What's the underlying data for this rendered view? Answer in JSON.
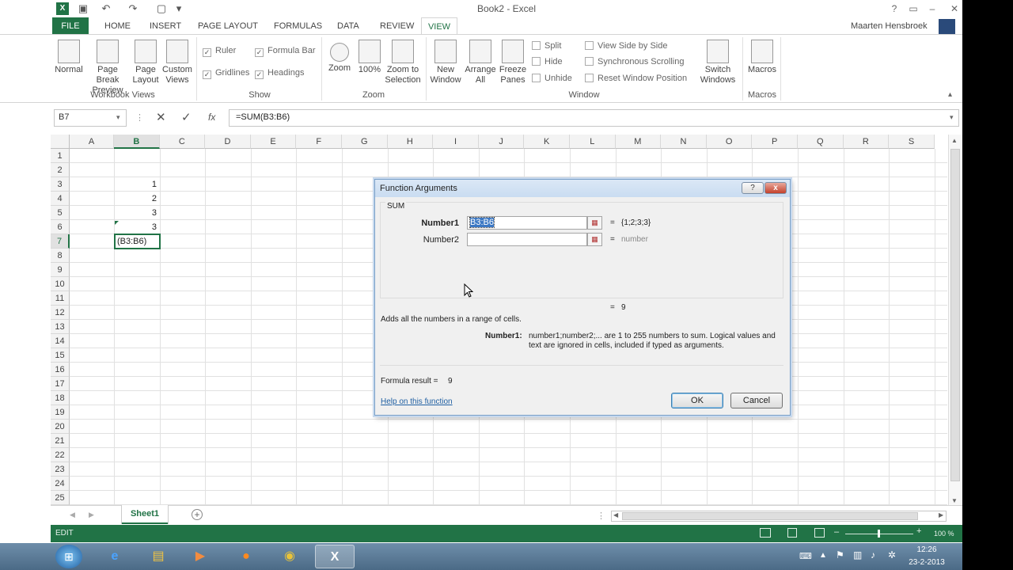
{
  "window": {
    "title": "Book2 - Excel",
    "app_icon_label": "X"
  },
  "ribbon_tabs": [
    {
      "label": "FILE"
    },
    {
      "label": "HOME"
    },
    {
      "label": "INSERT"
    },
    {
      "label": "PAGE LAYOUT"
    },
    {
      "label": "FORMULAS"
    },
    {
      "label": "DATA"
    },
    {
      "label": "REVIEW"
    },
    {
      "label": "VIEW"
    }
  ],
  "user": {
    "name": "Maarten Hensbroek"
  },
  "ribbon": {
    "workbook_views": {
      "label": "Workbook Views",
      "normal": "Normal",
      "page_break_1": "Page Break",
      "page_break_2": "Preview",
      "page_layout_1": "Page",
      "page_layout_2": "Layout",
      "custom_1": "Custom",
      "custom_2": "Views"
    },
    "show": {
      "label": "Show",
      "ruler": "Ruler",
      "formula_bar": "Formula Bar",
      "gridlines": "Gridlines",
      "headings": "Headings"
    },
    "zoom": {
      "label": "Zoom",
      "zoom": "Zoom",
      "zoom100": "100%",
      "zoom_sel_1": "Zoom to",
      "zoom_sel_2": "Selection"
    },
    "window": {
      "label": "Window",
      "new_1": "New",
      "new_2": "Window",
      "arrange_1": "Arrange",
      "arrange_2": "All",
      "freeze_1": "Freeze",
      "freeze_2": "Panes",
      "split": "Split",
      "hide": "Hide",
      "unhide": "Unhide",
      "side_by_side": "View Side by Side",
      "sync_scroll": "Synchronous Scrolling",
      "reset_pos": "Reset Window Position",
      "switch_1": "Switch",
      "switch_2": "Windows"
    },
    "macros": {
      "label": "Macros",
      "macros": "Macros"
    }
  },
  "formula_bar": {
    "name_box": "B7",
    "formula": "=SUM(B3:B6)"
  },
  "columns": [
    "A",
    "B",
    "C",
    "D",
    "E",
    "F",
    "G",
    "H",
    "I",
    "J",
    "K",
    "L",
    "M",
    "N",
    "O",
    "P",
    "Q",
    "R",
    "S"
  ],
  "rows": [
    "1",
    "2",
    "3",
    "4",
    "5",
    "6",
    "7",
    "8",
    "9",
    "10",
    "11",
    "12",
    "13",
    "14",
    "15",
    "16",
    "17",
    "18",
    "19",
    "20",
    "21",
    "22",
    "23",
    "24",
    "25"
  ],
  "cells": {
    "B3": "1",
    "B4": "2",
    "B5": "3",
    "B6": "3",
    "B7": "(B3:B6)"
  },
  "sheet_tabs": [
    {
      "label": "Sheet1"
    }
  ],
  "status": {
    "mode": "EDIT",
    "zoom": "100 %"
  },
  "taskbar": {
    "time": "12:26",
    "date": "23-2-2013"
  },
  "dialog": {
    "title": "Function Arguments",
    "function_name": "SUM",
    "args": [
      {
        "label": "Number1",
        "value": "B3:B6",
        "result": "{1;2;3;3}"
      },
      {
        "label": "Number2",
        "value": "",
        "result": "number"
      }
    ],
    "total_result": "9",
    "eq_sign": "=",
    "description": "Adds all the numbers in a range of cells.",
    "arg_help_label": "Number1:",
    "arg_help_line1": "number1;number2;... are 1 to 255 numbers to sum. Logical values and",
    "arg_help_line2": "text are ignored in cells, included if typed as arguments.",
    "formula_result_label": "Formula result =",
    "formula_result_value": "9",
    "help_link": "Help on this function",
    "ok": "OK",
    "cancel": "Cancel",
    "help_btn": "?",
    "close_btn": "x"
  }
}
